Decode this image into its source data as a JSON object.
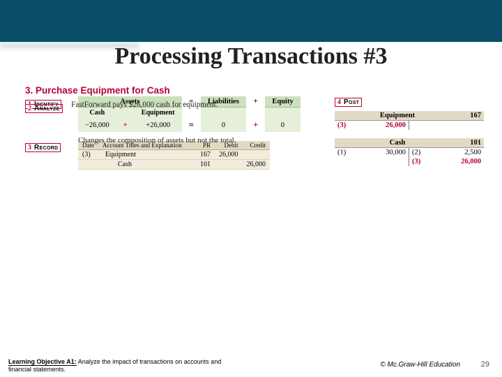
{
  "title": "Processing Transactions #3",
  "section_heading": "3. Purchase Equipment for Cash",
  "steps": {
    "s1_num": "1",
    "s1_label": "Identify",
    "s2_num": "2",
    "s2_label": "Analyze",
    "s3_num": "3",
    "s3_label": "Record",
    "s4_num": "4",
    "s4_label": "Post"
  },
  "identify_text": "FastForward pays $26,000 cash for equipment.",
  "equation": {
    "assets_label": "Assets",
    "cash_label": "Cash",
    "equip_label": "Equipment",
    "liab_label": "Liabilities",
    "equity_label": "Equity",
    "cash_val": "−26,000",
    "equip_val": "+26,000",
    "liab_val": "0",
    "equity_val": "0",
    "eq_sign": "=",
    "plus_sign": "+",
    "minus_sign": "−"
  },
  "note": "Changes the composition of assets but not the total.",
  "journal": {
    "h_date": "Date",
    "h_acc": "Account Titles and Explanation",
    "h_pr": "PR",
    "h_debit": "Debit",
    "h_credit": "Credit",
    "r1_date": "(3)",
    "r1_acc": "Equipment",
    "r1_pr": "167",
    "r1_debit": "26,000",
    "r1_credit": "",
    "r2_date": "",
    "r2_acc": "Cash",
    "r2_pr": "101",
    "r2_debit": "",
    "r2_credit": "26,000"
  },
  "ledger_equipment": {
    "name": "Equipment",
    "no": "167",
    "l1_ref": "(3)",
    "l1_amt": "26,000"
  },
  "ledger_cash": {
    "name": "Cash",
    "no": "101",
    "l1_ref": "(1)",
    "l1_amt": "30,000",
    "r1_ref": "(2)",
    "r1_amt": "2,500",
    "r2_ref": "(3)",
    "r2_amt": "26,000"
  },
  "footer_bold": "Learning Objective A1:",
  "footer_rest": " Analyze the impact of transactions on accounts and financial statements.",
  "copyright": "© Mc.Graw-Hill Education",
  "page_number": "29"
}
